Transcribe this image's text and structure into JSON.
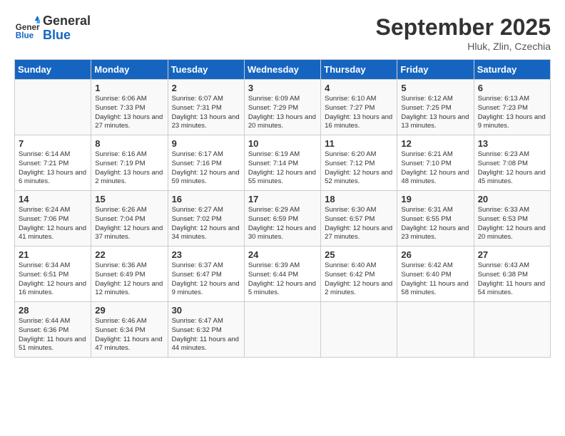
{
  "header": {
    "logo_general": "General",
    "logo_blue": "Blue",
    "month_title": "September 2025",
    "location": "Hluk, Zlin, Czechia"
  },
  "weekdays": [
    "Sunday",
    "Monday",
    "Tuesday",
    "Wednesday",
    "Thursday",
    "Friday",
    "Saturday"
  ],
  "weeks": [
    [
      {
        "day": "",
        "info": ""
      },
      {
        "day": "1",
        "info": "Sunrise: 6:06 AM\nSunset: 7:33 PM\nDaylight: 13 hours and 27 minutes."
      },
      {
        "day": "2",
        "info": "Sunrise: 6:07 AM\nSunset: 7:31 PM\nDaylight: 13 hours and 23 minutes."
      },
      {
        "day": "3",
        "info": "Sunrise: 6:09 AM\nSunset: 7:29 PM\nDaylight: 13 hours and 20 minutes."
      },
      {
        "day": "4",
        "info": "Sunrise: 6:10 AM\nSunset: 7:27 PM\nDaylight: 13 hours and 16 minutes."
      },
      {
        "day": "5",
        "info": "Sunrise: 6:12 AM\nSunset: 7:25 PM\nDaylight: 13 hours and 13 minutes."
      },
      {
        "day": "6",
        "info": "Sunrise: 6:13 AM\nSunset: 7:23 PM\nDaylight: 13 hours and 9 minutes."
      }
    ],
    [
      {
        "day": "7",
        "info": "Sunrise: 6:14 AM\nSunset: 7:21 PM\nDaylight: 13 hours and 6 minutes."
      },
      {
        "day": "8",
        "info": "Sunrise: 6:16 AM\nSunset: 7:19 PM\nDaylight: 13 hours and 2 minutes."
      },
      {
        "day": "9",
        "info": "Sunrise: 6:17 AM\nSunset: 7:16 PM\nDaylight: 12 hours and 59 minutes."
      },
      {
        "day": "10",
        "info": "Sunrise: 6:19 AM\nSunset: 7:14 PM\nDaylight: 12 hours and 55 minutes."
      },
      {
        "day": "11",
        "info": "Sunrise: 6:20 AM\nSunset: 7:12 PM\nDaylight: 12 hours and 52 minutes."
      },
      {
        "day": "12",
        "info": "Sunrise: 6:21 AM\nSunset: 7:10 PM\nDaylight: 12 hours and 48 minutes."
      },
      {
        "day": "13",
        "info": "Sunrise: 6:23 AM\nSunset: 7:08 PM\nDaylight: 12 hours and 45 minutes."
      }
    ],
    [
      {
        "day": "14",
        "info": "Sunrise: 6:24 AM\nSunset: 7:06 PM\nDaylight: 12 hours and 41 minutes."
      },
      {
        "day": "15",
        "info": "Sunrise: 6:26 AM\nSunset: 7:04 PM\nDaylight: 12 hours and 37 minutes."
      },
      {
        "day": "16",
        "info": "Sunrise: 6:27 AM\nSunset: 7:02 PM\nDaylight: 12 hours and 34 minutes."
      },
      {
        "day": "17",
        "info": "Sunrise: 6:29 AM\nSunset: 6:59 PM\nDaylight: 12 hours and 30 minutes."
      },
      {
        "day": "18",
        "info": "Sunrise: 6:30 AM\nSunset: 6:57 PM\nDaylight: 12 hours and 27 minutes."
      },
      {
        "day": "19",
        "info": "Sunrise: 6:31 AM\nSunset: 6:55 PM\nDaylight: 12 hours and 23 minutes."
      },
      {
        "day": "20",
        "info": "Sunrise: 6:33 AM\nSunset: 6:53 PM\nDaylight: 12 hours and 20 minutes."
      }
    ],
    [
      {
        "day": "21",
        "info": "Sunrise: 6:34 AM\nSunset: 6:51 PM\nDaylight: 12 hours and 16 minutes."
      },
      {
        "day": "22",
        "info": "Sunrise: 6:36 AM\nSunset: 6:49 PM\nDaylight: 12 hours and 12 minutes."
      },
      {
        "day": "23",
        "info": "Sunrise: 6:37 AM\nSunset: 6:47 PM\nDaylight: 12 hours and 9 minutes."
      },
      {
        "day": "24",
        "info": "Sunrise: 6:39 AM\nSunset: 6:44 PM\nDaylight: 12 hours and 5 minutes."
      },
      {
        "day": "25",
        "info": "Sunrise: 6:40 AM\nSunset: 6:42 PM\nDaylight: 12 hours and 2 minutes."
      },
      {
        "day": "26",
        "info": "Sunrise: 6:42 AM\nSunset: 6:40 PM\nDaylight: 11 hours and 58 minutes."
      },
      {
        "day": "27",
        "info": "Sunrise: 6:43 AM\nSunset: 6:38 PM\nDaylight: 11 hours and 54 minutes."
      }
    ],
    [
      {
        "day": "28",
        "info": "Sunrise: 6:44 AM\nSunset: 6:36 PM\nDaylight: 11 hours and 51 minutes."
      },
      {
        "day": "29",
        "info": "Sunrise: 6:46 AM\nSunset: 6:34 PM\nDaylight: 11 hours and 47 minutes."
      },
      {
        "day": "30",
        "info": "Sunrise: 6:47 AM\nSunset: 6:32 PM\nDaylight: 11 hours and 44 minutes."
      },
      {
        "day": "",
        "info": ""
      },
      {
        "day": "",
        "info": ""
      },
      {
        "day": "",
        "info": ""
      },
      {
        "day": "",
        "info": ""
      }
    ]
  ]
}
